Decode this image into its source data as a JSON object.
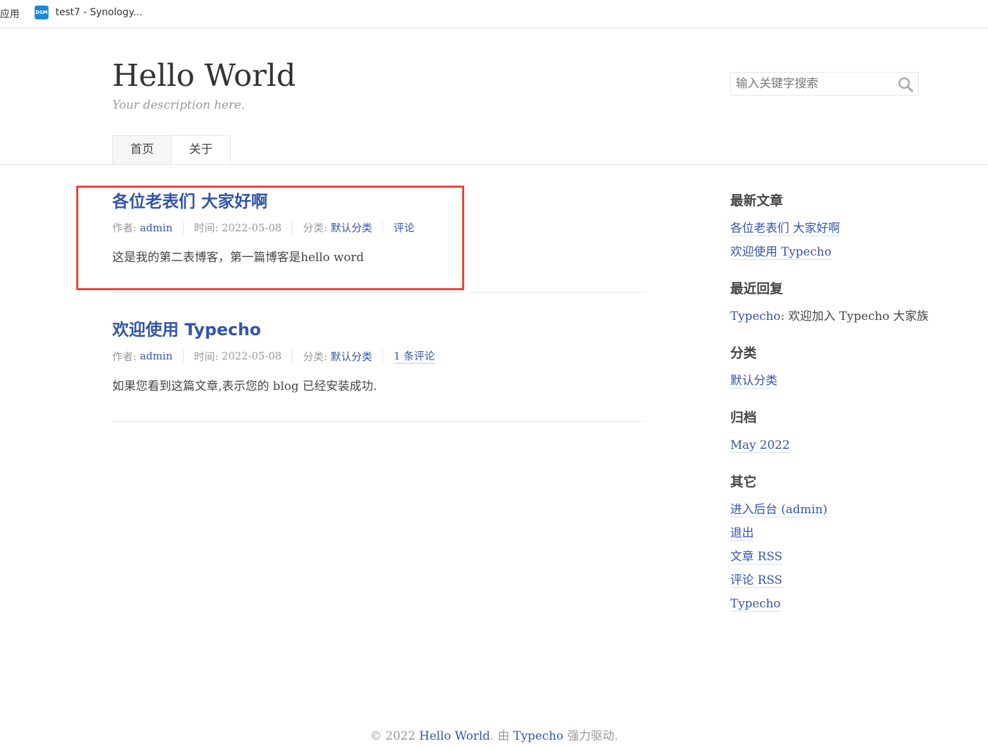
{
  "bookmarks": {
    "apps_label": "应用",
    "item_label": "test7 - Synology...",
    "item_icon": "DSM"
  },
  "header": {
    "title": "Hello World",
    "description": "Your description here.",
    "search_placeholder": "输入关键字搜索"
  },
  "nav": {
    "items": [
      {
        "label": "首页"
      },
      {
        "label": "关于"
      }
    ]
  },
  "posts": [
    {
      "title": "各位老表们 大家好啊",
      "author_label": "作者: ",
      "author": "admin",
      "time_label": "时间: ",
      "time": "2022-05-08",
      "category_label": "分类: ",
      "category": "默认分类",
      "comments": "评论",
      "excerpt": "这是我的第二表博客，第一篇博客是hello word"
    },
    {
      "title": "欢迎使用 Typecho",
      "author_label": "作者: ",
      "author": "admin",
      "time_label": "时间: ",
      "time": "2022-05-08",
      "category_label": "分类: ",
      "category": "默认分类",
      "comments": "1 条评论",
      "excerpt": "如果您看到这篇文章,表示您的 blog 已经安装成功."
    }
  ],
  "sidebar": {
    "recent_posts": {
      "title": "最新文章",
      "items": [
        "各位老表们 大家好啊",
        "欢迎使用 Typecho"
      ]
    },
    "recent_comments": {
      "title": "最近回复",
      "author": "Typecho",
      "separator": ": ",
      "text": "欢迎加入 Typecho 大家族"
    },
    "categories": {
      "title": "分类",
      "items": [
        "默认分类"
      ]
    },
    "archives": {
      "title": "归档",
      "items": [
        "May 2022"
      ]
    },
    "misc": {
      "title": "其它",
      "items": [
        "进入后台 (admin)",
        "退出",
        "文章 RSS",
        "评论 RSS",
        "Typecho"
      ]
    }
  },
  "footer": {
    "prefix": "© 2022 ",
    "site": "Hello World",
    "middle": ". 由 ",
    "powered": "Typecho",
    "suffix": " 强力驱动."
  },
  "colors": {
    "link": "#3354AA",
    "highlight_box": "#e8453c"
  }
}
